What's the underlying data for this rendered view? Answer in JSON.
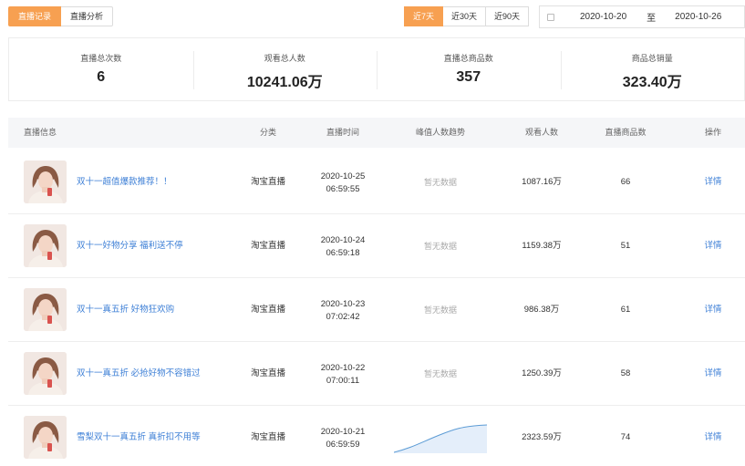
{
  "top_tabs": [
    {
      "label": "直播记录",
      "active": true
    },
    {
      "label": "直播分析",
      "active": false
    }
  ],
  "range_tabs": [
    {
      "label": "近7天",
      "active": true
    },
    {
      "label": "近30天",
      "active": false
    },
    {
      "label": "近90天",
      "active": false
    }
  ],
  "date_range": {
    "start": "2020-10-20",
    "separator": "至",
    "end": "2020-10-26"
  },
  "stats": [
    {
      "label": "直播总次数",
      "value": "6"
    },
    {
      "label": "观看总人数",
      "value": "10241.06万"
    },
    {
      "label": "直播总商品数",
      "value": "357"
    },
    {
      "label": "商品总销量",
      "value": "323.40万"
    }
  ],
  "table": {
    "headers": {
      "info": "直播信息",
      "category": "分类",
      "time": "直播时间",
      "trend": "峰值人数趋势",
      "viewers": "观看人数",
      "products": "直播商品数",
      "action": "操作"
    },
    "rows": [
      {
        "title": "双十一超值爆款推荐！！",
        "category": "淘宝直播",
        "date": "2020-10-25",
        "clock": "06:59:55",
        "trend": "暂无数据",
        "viewers": "1087.16万",
        "products": "66",
        "action": "详情"
      },
      {
        "title": "双十一好物分享 福利送不停",
        "category": "淘宝直播",
        "date": "2020-10-24",
        "clock": "06:59:18",
        "trend": "暂无数据",
        "viewers": "1159.38万",
        "products": "51",
        "action": "详情"
      },
      {
        "title": "双十一真五折 好物狂欢购",
        "category": "淘宝直播",
        "date": "2020-10-23",
        "clock": "07:02:42",
        "trend": "暂无数据",
        "viewers": "986.38万",
        "products": "61",
        "action": "详情"
      },
      {
        "title": "双十一真五折 必抢好物不容错过",
        "category": "淘宝直播",
        "date": "2020-10-22",
        "clock": "07:00:11",
        "trend": "暂无数据",
        "viewers": "1250.39万",
        "products": "58",
        "action": "详情"
      },
      {
        "title": "雪梨双十一真五折 真折扣不用等",
        "category": "淘宝直播",
        "date": "2020-10-21",
        "clock": "06:59:59",
        "trend": "",
        "viewers": "2323.59万",
        "products": "74",
        "action": "详情"
      }
    ]
  },
  "colors": {
    "accent": "#f7a051",
    "link": "#3d7fd6",
    "sparkline": "#5b9bd5"
  },
  "icons": {
    "date": "calendar-icon"
  }
}
